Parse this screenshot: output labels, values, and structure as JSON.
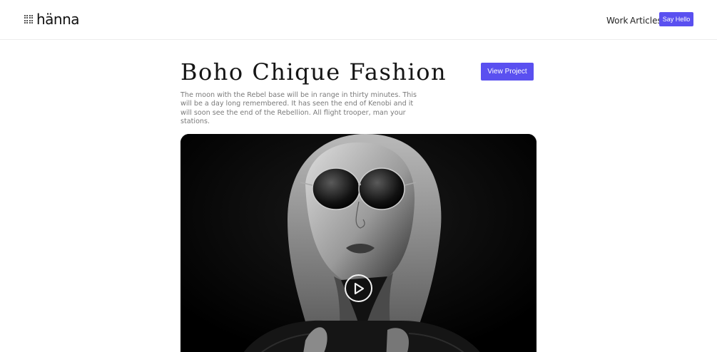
{
  "header": {
    "logo": {
      "icon": "dot-grid-icon",
      "text": "hänna"
    },
    "nav": [
      {
        "label": "Work"
      },
      {
        "label": "Articles"
      }
    ],
    "cta_label": "Say Hello"
  },
  "project": {
    "title": "Boho Chique Fashion",
    "view_label": "View Project",
    "description": "The moon with the Rebel base will be in range in thirty minutes. This will be a day long remembered. It has seen the end of Kenobi and it will soon see the end of the Rebellion. All flight trooper, man your stations."
  },
  "video": {
    "play_icon": "play-icon",
    "image": "black-and-white portrait of a woman wearing round sunglasses"
  },
  "colors": {
    "accent": "#5a50f0",
    "text": "#1a1a1a",
    "muted": "#7a7a7a",
    "background": "#ffffff"
  }
}
